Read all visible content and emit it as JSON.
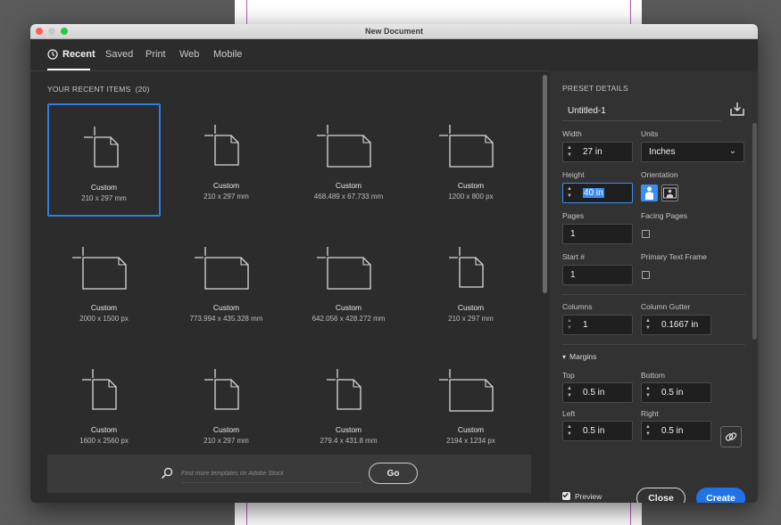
{
  "window": {
    "title": "New Document"
  },
  "tabs": [
    {
      "label": "Recent",
      "icon": "clock-icon",
      "active": true
    },
    {
      "label": "Saved"
    },
    {
      "label": "Print"
    },
    {
      "label": "Web"
    },
    {
      "label": "Mobile"
    }
  ],
  "recent": {
    "heading": "YOUR RECENT ITEMS",
    "count": "(20)",
    "items": [
      {
        "name": "Custom",
        "size": "210 x 297 mm",
        "orientation": "portrait"
      },
      {
        "name": "Custom",
        "size": "210 x 297 mm",
        "orientation": "portrait"
      },
      {
        "name": "Custom",
        "size": "468.489 x 67.733 mm",
        "orientation": "landscape"
      },
      {
        "name": "Custom",
        "size": "1200 x 800 px",
        "orientation": "landscape"
      },
      {
        "name": "Custom",
        "size": "2000 x 1500 px",
        "orientation": "landscape"
      },
      {
        "name": "Custom",
        "size": "773.994 x 435.328 mm",
        "orientation": "landscape"
      },
      {
        "name": "Custom",
        "size": "642.056 x 428.272 mm",
        "orientation": "landscape"
      },
      {
        "name": "Custom",
        "size": "210 x 297 mm",
        "orientation": "portrait"
      },
      {
        "name": "Custom",
        "size": "1600 x 2560 px",
        "orientation": "portrait"
      },
      {
        "name": "Custom",
        "size": "210 x 297 mm",
        "orientation": "portrait"
      },
      {
        "name": "Custom",
        "size": "279.4 x 431.8 mm",
        "orientation": "portrait"
      },
      {
        "name": "Custom",
        "size": "2194 x 1234 px",
        "orientation": "landscape"
      }
    ]
  },
  "search": {
    "placeholder": "Find more templates on Adobe Stock",
    "go_label": "Go"
  },
  "preset": {
    "heading": "PRESET DETAILS",
    "doc_name": "Untitled-1",
    "width_label": "Width",
    "width": "27 in",
    "units_label": "Units",
    "units": "Inches",
    "height_label": "Height",
    "height": "40 in",
    "orientation_label": "Orientation",
    "pages_label": "Pages",
    "pages": "1",
    "facing_label": "Facing Pages",
    "start_label": "Start #",
    "start": "1",
    "primary_label": "Primary Text Frame",
    "columns_label": "Columns",
    "columns": "1",
    "gutter_label": "Column Gutter",
    "gutter": "0.1667 in",
    "margins_label": "Margins",
    "top_label": "Top",
    "top": "0.5 in",
    "bottom_label": "Bottom",
    "bottom": "0.5 in",
    "left_label": "Left",
    "left": "0.5 in",
    "right_label": "Right",
    "right": "0.5 in"
  },
  "footer": {
    "preview_label": "Preview",
    "close_label": "Close",
    "create_label": "Create"
  },
  "colors": {
    "accent": "#1f73e6",
    "selection": "#2e7ee6",
    "panel": "#323232",
    "dialog": "#2c2c2c"
  }
}
